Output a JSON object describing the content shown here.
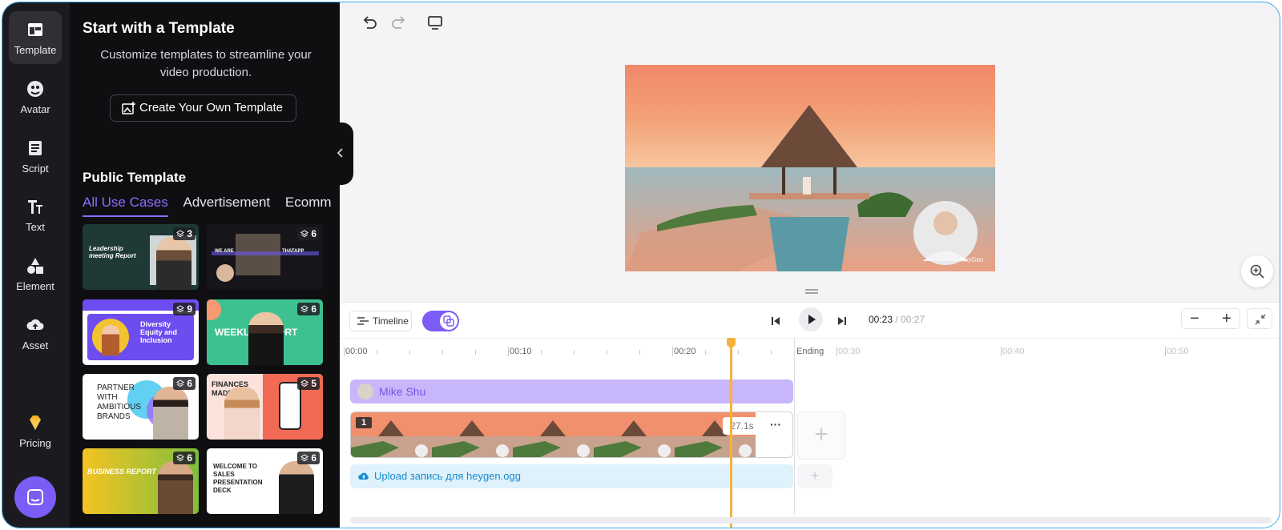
{
  "sidebar": {
    "items": [
      {
        "label": "Template",
        "icon": "template-icon",
        "active": true
      },
      {
        "label": "Avatar",
        "icon": "avatar-icon"
      },
      {
        "label": "Script",
        "icon": "script-icon"
      },
      {
        "label": "Text",
        "icon": "text-icon"
      },
      {
        "label": "Element",
        "icon": "shapes-icon"
      },
      {
        "label": "Asset",
        "icon": "cloud-upload-icon"
      }
    ],
    "pricing_label": "Pricing",
    "chat_icon": "chat-icon"
  },
  "panel": {
    "title": "Start with a Template",
    "description": "Customize templates to streamline your video production.",
    "create_button": "Create Your Own Template",
    "public_title": "Public Template",
    "tabs": [
      "All Use Cases",
      "Advertisement",
      "Ecomm"
    ],
    "cards": [
      {
        "count": "3",
        "text": "Leadership meeting Report"
      },
      {
        "count": "6",
        "text": "WE ARE",
        "text2": "THATAPP"
      },
      {
        "count": "9",
        "text": "Diversity Equity and Inclusion"
      },
      {
        "count": "6",
        "text": "WEEKLY REPORT"
      },
      {
        "count": "6",
        "text": "PARTNER WITH AMBITIOUS BRANDS"
      },
      {
        "count": "5",
        "text": "FINANCES MADE EASY"
      },
      {
        "count": "6",
        "text": "BUSINESS REPORT"
      },
      {
        "count": "6",
        "text": "WELCOME TO SALES PRESENTATION DECK"
      }
    ]
  },
  "toolbar": {
    "undo_icon": "undo-icon",
    "redo_icon": "redo-icon",
    "screen_icon": "monitor-icon"
  },
  "preview": {
    "watermark": "HeyGen"
  },
  "timeline": {
    "timeline_label": "Timeline",
    "time_current": "00:23",
    "time_total": "/ 00:27",
    "ruler": [
      "00:00",
      "00:10",
      "00:20",
      "Ending",
      "00:30",
      "00:40",
      "00:50"
    ],
    "avatar_track": "Mike Shu",
    "scene_number": "1",
    "scene_duration": "27.1s",
    "more": "···",
    "audio_track": "Upload запись для heygen.ogg",
    "add_label": "+"
  },
  "colors": {
    "accent": "#7b5cf5",
    "panel_bg": "#0f0f12",
    "playhead": "#f5b33c",
    "avatar_track": "#c8b6fb",
    "audio_track": "#dff1fb"
  }
}
